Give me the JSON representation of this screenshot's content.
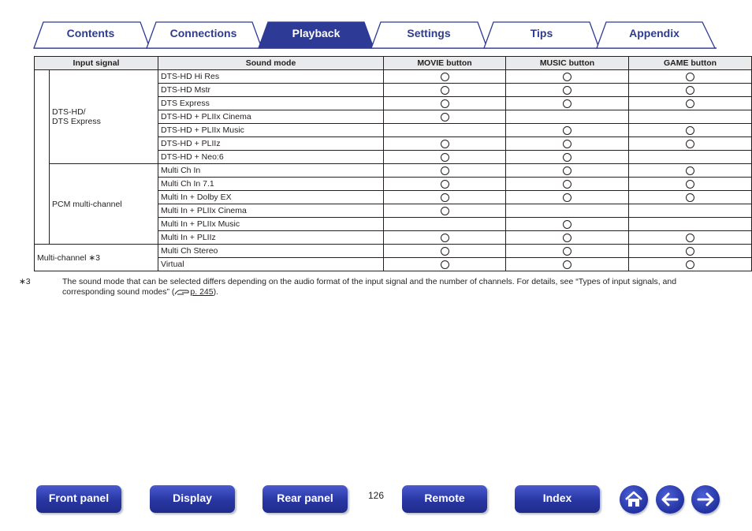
{
  "tabs": [
    {
      "label": "Contents",
      "active": false
    },
    {
      "label": "Connections",
      "active": false
    },
    {
      "label": "Playback",
      "active": true
    },
    {
      "label": "Settings",
      "active": false
    },
    {
      "label": "Tips",
      "active": false
    },
    {
      "label": "Appendix",
      "active": false
    }
  ],
  "colors": {
    "tab_active": "#2d3a96",
    "tab_text": "#2f3c8c",
    "button": "#2836a3",
    "header_bg": "#e9eaeb"
  },
  "table": {
    "headers": [
      "Input signal",
      "Sound mode",
      "MOVIE button",
      "MUSIC button",
      "GAME button"
    ],
    "groups": [
      {
        "label": "DTS-HD/\nDTS Express",
        "rows": [
          {
            "mode": "DTS-HD Hi Res",
            "movie": true,
            "music": true,
            "game": true
          },
          {
            "mode": "DTS-HD Mstr",
            "movie": true,
            "music": true,
            "game": true
          },
          {
            "mode": "DTS Express",
            "movie": true,
            "music": true,
            "game": true
          },
          {
            "mode": "DTS-HD + PLIIx Cinema",
            "movie": true,
            "music": false,
            "game": false
          },
          {
            "mode": "DTS-HD + PLIIx Music",
            "movie": false,
            "music": true,
            "game": true
          },
          {
            "mode": "DTS-HD + PLIIz",
            "movie": true,
            "music": true,
            "game": true
          },
          {
            "mode": "DTS-HD + Neo:6",
            "movie": true,
            "music": true,
            "game": false
          }
        ]
      },
      {
        "label": "PCM multi-channel",
        "rows": [
          {
            "mode": "Multi Ch In",
            "movie": true,
            "music": true,
            "game": true
          },
          {
            "mode": "Multi Ch In 7.1",
            "movie": true,
            "music": true,
            "game": true
          },
          {
            "mode": "Multi In + Dolby EX",
            "movie": true,
            "music": true,
            "game": true
          },
          {
            "mode": "Multi In + PLIIx Cinema",
            "movie": true,
            "music": false,
            "game": false
          },
          {
            "mode": "Multi In + PLIIx Music",
            "movie": false,
            "music": true,
            "game": false
          },
          {
            "mode": "Multi In + PLIIz",
            "movie": true,
            "music": true,
            "game": true
          }
        ]
      }
    ],
    "multichannel": {
      "label": "Multi-channel ∗3",
      "rows": [
        {
          "mode": "Multi Ch Stereo",
          "movie": true,
          "music": true,
          "game": true
        },
        {
          "mode": "Virtual",
          "movie": true,
          "music": true,
          "game": true
        }
      ]
    }
  },
  "footnote": {
    "marker": "∗3",
    "text": "The sound mode that can be selected differs depending on the audio format of the input signal and the number of channels. For details, see “Types of input signals, and corresponding sound modes” (",
    "link": "p. 245",
    "tail": ")."
  },
  "nav": {
    "buttons": [
      "Front panel",
      "Display",
      "Rear panel",
      "Remote",
      "Index"
    ],
    "page_number": "126",
    "icons": [
      "home-icon",
      "back-arrow-icon",
      "forward-arrow-icon"
    ]
  }
}
